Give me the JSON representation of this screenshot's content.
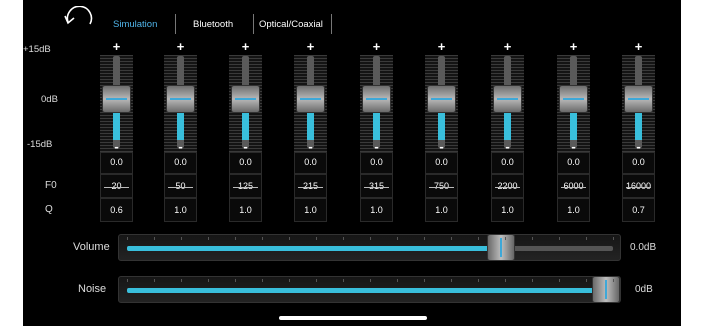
{
  "tabs": [
    {
      "label": "Simulation",
      "active": true
    },
    {
      "label": "Bluetooth",
      "active": false
    },
    {
      "label": "Optical/Coaxial",
      "active": false
    }
  ],
  "db_scale": {
    "top": "+15dB",
    "mid": "0dB",
    "bottom": "-15dB"
  },
  "row_labels": {
    "f0": "F0",
    "q": "Q"
  },
  "plus_symbol": "+",
  "minus_symbol": "-",
  "bands": [
    {
      "gain": "0.0",
      "f0": "20",
      "q": "0.6"
    },
    {
      "gain": "0.0",
      "f0": "50",
      "q": "1.0"
    },
    {
      "gain": "0.0",
      "f0": "125",
      "q": "1.0"
    },
    {
      "gain": "0.0",
      "f0": "215",
      "q": "1.0"
    },
    {
      "gain": "0.0",
      "f0": "315",
      "q": "1.0"
    },
    {
      "gain": "0.0",
      "f0": "750",
      "q": "1.0"
    },
    {
      "gain": "0.0",
      "f0": "2200",
      "q": "1.0"
    },
    {
      "gain": "0.0",
      "f0": "6000",
      "q": "1.0"
    },
    {
      "gain": "0.0",
      "f0": "16000",
      "q": "0.7"
    }
  ],
  "volume": {
    "label": "Volume",
    "value": "0.0dB",
    "level": 0.77
  },
  "noise": {
    "label": "Noise",
    "value": "0dB",
    "level": 1.0
  },
  "icons": {
    "back": "back-arrow-icon"
  },
  "colors": {
    "accent": "#39bfdc",
    "tab_active": "#4fb3e8",
    "background": "#000000"
  }
}
